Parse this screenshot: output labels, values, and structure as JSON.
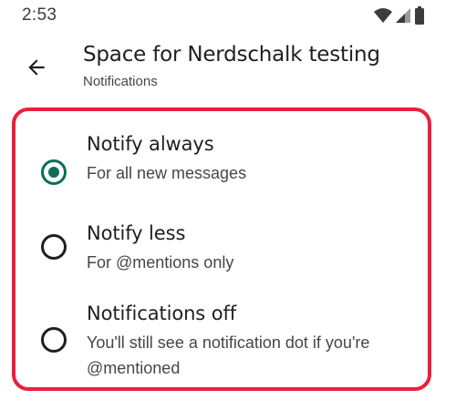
{
  "status_bar": {
    "time": "2:53",
    "icons": [
      "wifi-icon",
      "signal-icon",
      "battery-icon"
    ]
  },
  "header": {
    "title": "Space for Nerdschalk testing",
    "subtitle": "Notifications"
  },
  "options": [
    {
      "title": "Notify always",
      "description": "For all new messages",
      "selected": true
    },
    {
      "title": "Notify less",
      "description": "For @mentions only",
      "selected": false
    },
    {
      "title": "Notifications off",
      "description": "You'll still see a notification dot if you're @mentioned",
      "selected": false
    }
  ],
  "colors": {
    "accent": "#0b6e58",
    "highlight_border": "#e8213a"
  }
}
